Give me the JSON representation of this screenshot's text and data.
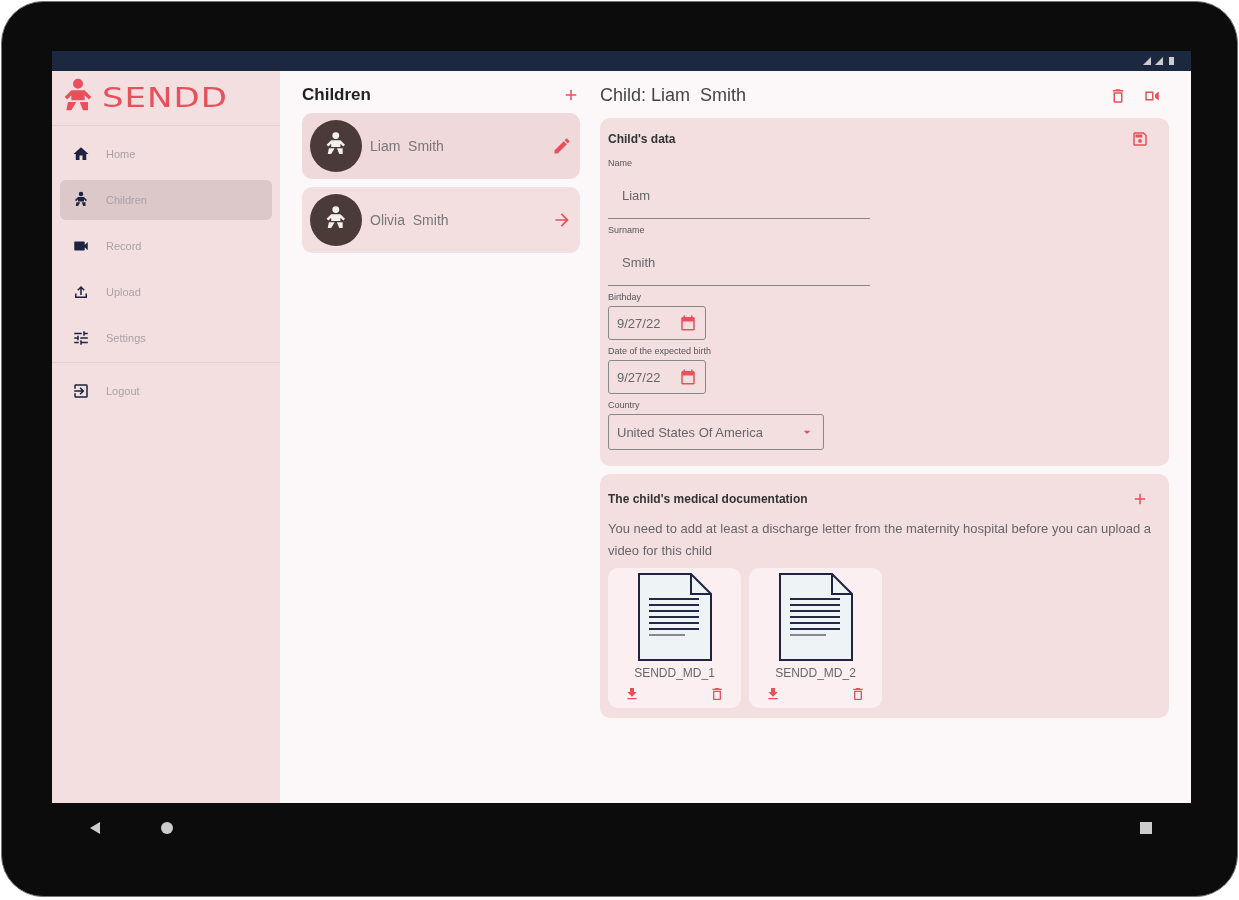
{
  "logo": {
    "text": "SENDD"
  },
  "nav": {
    "items": [
      {
        "label": "Home",
        "kind": "home",
        "selected": false
      },
      {
        "label": "Children",
        "kind": "baby",
        "selected": true
      },
      {
        "label": "Record",
        "kind": "video",
        "selected": false
      },
      {
        "label": "Upload",
        "kind": "upload",
        "selected": false
      },
      {
        "label": "Settings",
        "kind": "tune",
        "selected": false
      }
    ],
    "footer": [
      {
        "label": "Logout",
        "kind": "logout",
        "selected": false
      }
    ]
  },
  "children_list": {
    "title": "Children",
    "items": [
      {
        "name": "Liam  Smith",
        "selected": true
      },
      {
        "name": "Olivia  Smith",
        "selected": false
      }
    ]
  },
  "detail": {
    "title": "Child: Liam  Smith",
    "child_data": {
      "title": "Child's data",
      "fields": [
        {
          "kind": "text",
          "label": "Name",
          "value": "Liam"
        },
        {
          "kind": "text",
          "label": "Surname",
          "value": "Smith"
        },
        {
          "kind": "date",
          "label": "Birthday",
          "value": "9/27/22"
        },
        {
          "kind": "date",
          "label": "Date of the expected birth",
          "value": "9/27/22"
        },
        {
          "kind": "select",
          "label": "Country",
          "value": "United States Of America"
        }
      ]
    },
    "medical": {
      "title": "The child's medical documentation",
      "notice": "You need to add at least a discharge letter from the maternity hospital before you can upload a video for this child",
      "documents": [
        {
          "name": "SENDD_MD_1"
        },
        {
          "name": "SENDD_MD_2"
        }
      ]
    }
  }
}
